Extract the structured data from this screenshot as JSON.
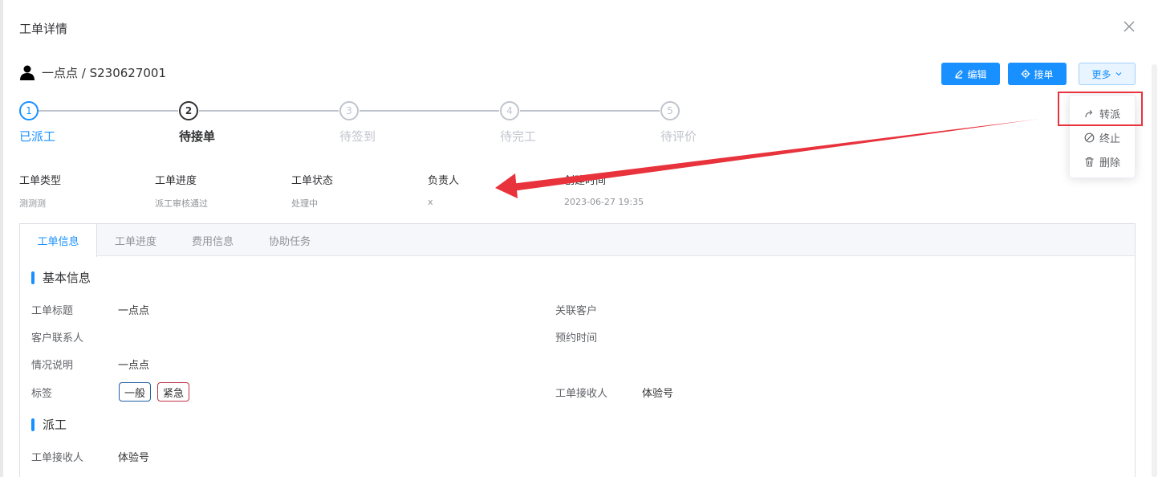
{
  "dialog": {
    "title": "工单详情"
  },
  "header": {
    "name": "一点点 / S230627001"
  },
  "buttons": {
    "edit_label": "编辑",
    "accept_label": "接单",
    "more_label": "更多"
  },
  "steps": [
    {
      "number": "1",
      "label": "已派工",
      "state": "done"
    },
    {
      "number": "2",
      "label": "待接单",
      "state": "active"
    },
    {
      "number": "3",
      "label": "待签到",
      "state": "pending"
    },
    {
      "number": "4",
      "label": "待完工",
      "state": "pending"
    },
    {
      "number": "5",
      "label": "待评价",
      "state": "pending"
    }
  ],
  "more_menu": {
    "items": [
      {
        "label": "转派",
        "icon": "share-icon"
      },
      {
        "label": "终止",
        "icon": "stop-icon"
      },
      {
        "label": "删除",
        "icon": "delete-icon"
      }
    ]
  },
  "summary": [
    {
      "label": "工单类型",
      "value": "测测测"
    },
    {
      "label": "工单进度",
      "value": "派工审核通过"
    },
    {
      "label": "工单状态",
      "value": "处理中"
    },
    {
      "label": "负责人",
      "value": "x"
    },
    {
      "label": "创建时间",
      "value": "2023-06-27 19:35"
    }
  ],
  "tabs": [
    {
      "label": "工单信息",
      "active": true
    },
    {
      "label": "工单进度",
      "active": false
    },
    {
      "label": "费用信息",
      "active": false
    },
    {
      "label": "协助任务",
      "active": false
    }
  ],
  "basic_info": {
    "section_title": "基本信息",
    "title_label": "工单标题",
    "title_value": "一点点",
    "customer_label": "关联客户",
    "contact_label": "客户联系人",
    "appointment_label": "预约时间",
    "description_label": "情况说明",
    "description_value": "一点点",
    "tags_label": "标签",
    "tags": [
      "一般",
      "紧急"
    ],
    "receiver_label": "工单接收人",
    "receiver_value": "体验号"
  },
  "dispatch": {
    "section_title": "派工",
    "receiver_label": "工单接收人",
    "receiver_value": "体验号"
  },
  "colors": {
    "primary": "#1890ff",
    "annotation_red": "#e8323c",
    "tag_urgent_border": "#c0304a"
  }
}
